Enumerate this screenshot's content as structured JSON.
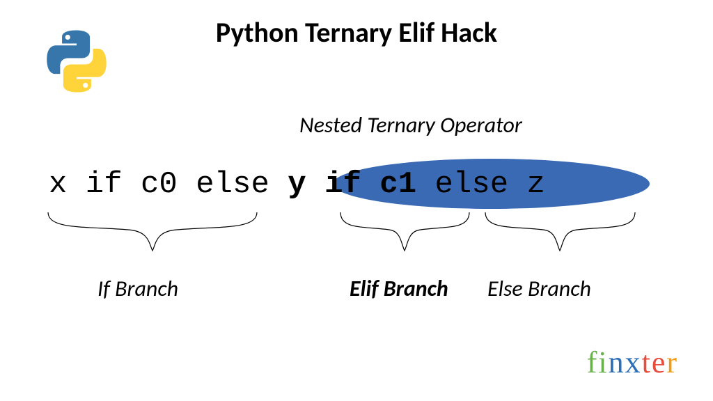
{
  "title": "Python Ternary Elif Hack",
  "subtitle": "Nested Ternary Operator",
  "code": {
    "part1": "x if c0 else ",
    "bold": "y if c1",
    "part2": " else z"
  },
  "labels": {
    "if_branch": "If Branch",
    "elif_branch": "Elif Branch",
    "else_branch": "Else Branch"
  },
  "finxter": {
    "letters": [
      "f",
      "i",
      "n",
      "x",
      "t",
      "e",
      "r"
    ],
    "colors": [
      "#6ab04c",
      "#6ab04c",
      "#2c6fb7",
      "#2c6fb7",
      "#e74c3c",
      "#e74c3c",
      "#f39c12"
    ]
  },
  "logo": {
    "blue": "#3776ab",
    "yellow": "#ffd43b"
  }
}
